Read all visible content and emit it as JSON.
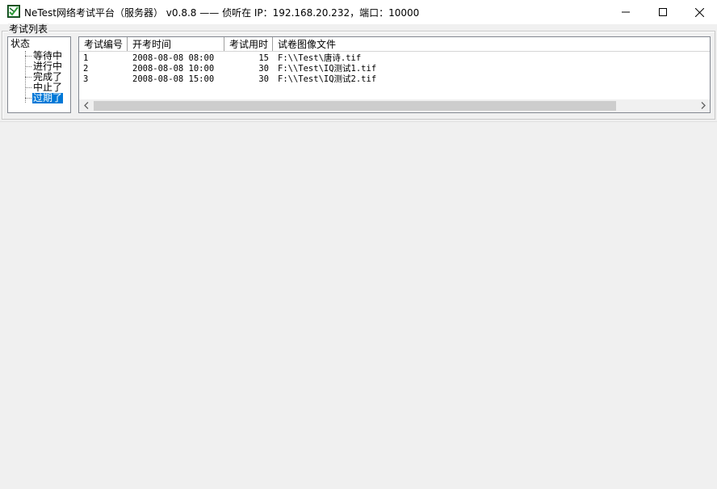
{
  "window": {
    "title": "NeTest网络考试平台（服务器） v0.8.8 —— 侦听在 IP：192.168.20.232，端口：10000",
    "icon": "app-logo-icon",
    "controls": [
      "minimize-icon",
      "maximize-icon",
      "close-icon"
    ]
  },
  "group": {
    "legend": "考试列表"
  },
  "tree": {
    "root": "状态",
    "items": [
      {
        "label": "等待中",
        "selected": false
      },
      {
        "label": "进行中",
        "selected": false
      },
      {
        "label": "完成了",
        "selected": false
      },
      {
        "label": "中止了",
        "selected": false
      },
      {
        "label": "过期了",
        "selected": true
      }
    ]
  },
  "list": {
    "columns": [
      "考试编号",
      "开考时间",
      "考试用时",
      "试卷图像文件"
    ],
    "rows": [
      {
        "id": "1",
        "start": "2008-08-08 08:00",
        "duration": "15",
        "file": "F:\\\\Test\\唐诗.tif"
      },
      {
        "id": "2",
        "start": "2008-08-08 10:00",
        "duration": "30",
        "file": "F:\\\\Test\\IQ测试1.tif"
      },
      {
        "id": "3",
        "start": "2008-08-08 15:00",
        "duration": "30",
        "file": "F:\\\\Test\\IQ测试2.tif"
      }
    ]
  },
  "colors": {
    "selection": "#0078d7",
    "window_bg": "#f0f0f0",
    "scroll_thumb": "#cdcdcd"
  }
}
